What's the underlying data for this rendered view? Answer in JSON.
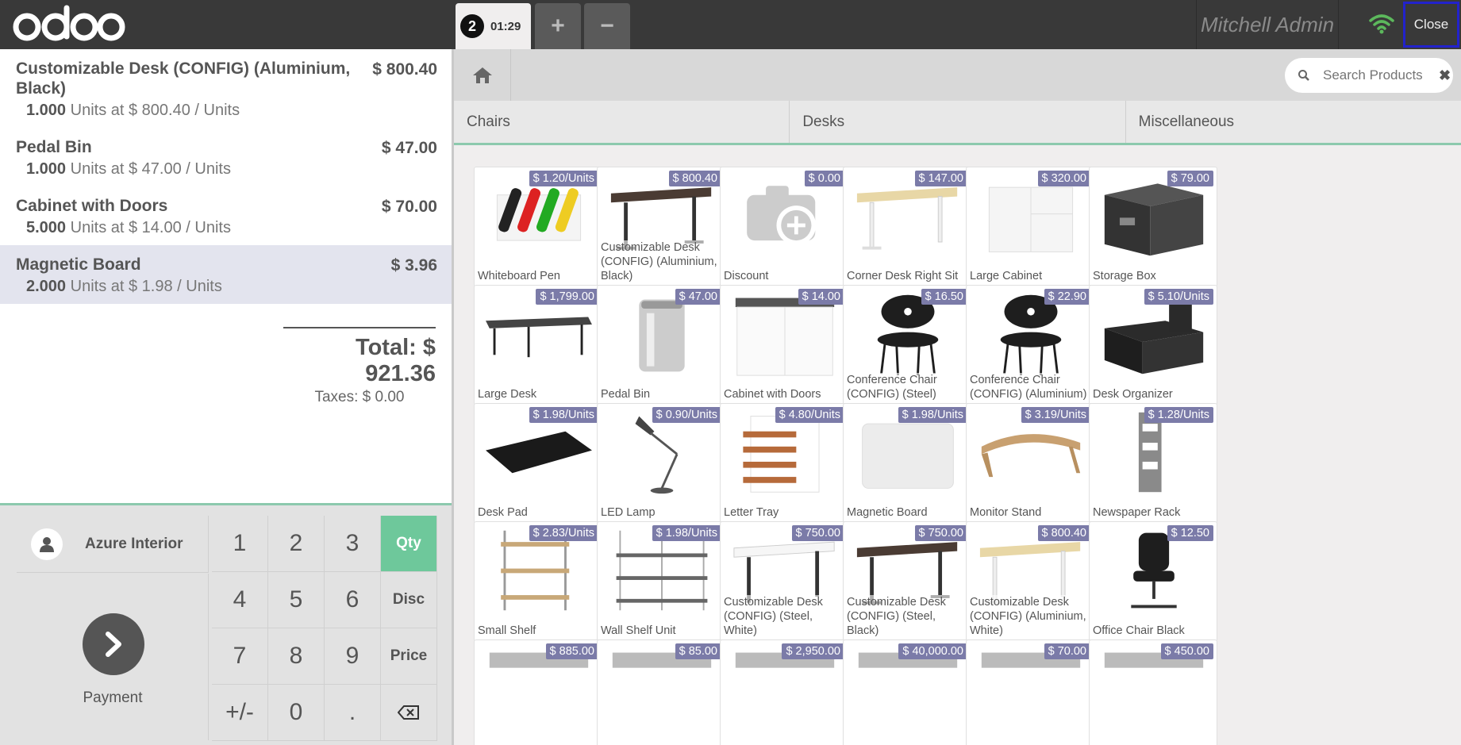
{
  "topbar": {
    "logo_text": "odoo",
    "order_number": "2",
    "order_time": "01:29",
    "add_order_label": "+",
    "delete_order_label": "−",
    "user_name": "Mitchell Admin",
    "close_label": "Close"
  },
  "order": {
    "lines": [
      {
        "name": "Customizable Desk (CONFIG) (Aluminium, Black)",
        "price": "$ 800.40",
        "qty": "1.000",
        "unit_info": "Units at $ 800.40 / Units",
        "selected": false
      },
      {
        "name": "Pedal Bin",
        "price": "$ 47.00",
        "qty": "1.000",
        "unit_info": "Units at $ 47.00 / Units",
        "selected": false
      },
      {
        "name": "Cabinet with Doors",
        "price": "$ 70.00",
        "qty": "5.000",
        "unit_info": "Units at $ 14.00 / Units",
        "selected": false
      },
      {
        "name": "Magnetic Board",
        "price": "$ 3.96",
        "qty": "2.000",
        "unit_info": "Units at $ 1.98 / Units",
        "selected": true
      }
    ],
    "total": "Total: $ 921.36",
    "taxes": "Taxes: $ 0.00"
  },
  "controls": {
    "customer_name": "Azure Interior",
    "payment_label": "Payment",
    "keys": [
      "1",
      "2",
      "3",
      "Qty",
      "4",
      "5",
      "6",
      "Disc",
      "7",
      "8",
      "9",
      "Price",
      "+/-",
      "0",
      "."
    ],
    "active_mode": "Qty"
  },
  "search": {
    "placeholder": "Search Products"
  },
  "categories": [
    "Chairs",
    "Desks",
    "Miscellaneous"
  ],
  "products": [
    {
      "name": "Whiteboard Pen",
      "price": "$ 1.20/Units",
      "icon": "whiteboard-pen"
    },
    {
      "name": "Customizable Desk (CONFIG) (Aluminium, Black)",
      "price": "$ 800.40",
      "icon": "desk-dark"
    },
    {
      "name": "Discount",
      "price": "$ 0.00",
      "icon": "discount-camera"
    },
    {
      "name": "Corner Desk Right Sit",
      "price": "$ 147.00",
      "icon": "desk-light"
    },
    {
      "name": "Large Cabinet",
      "price": "$ 320.00",
      "icon": "cabinet"
    },
    {
      "name": "Storage Box",
      "price": "$ 79.00",
      "icon": "storage-box"
    },
    {
      "name": "Large Desk",
      "price": "$ 1,799.00",
      "icon": "large-desk"
    },
    {
      "name": "Pedal Bin",
      "price": "$ 47.00",
      "icon": "pedal-bin"
    },
    {
      "name": "Cabinet with Doors",
      "price": "$ 14.00",
      "icon": "cabinet-doors"
    },
    {
      "name": "Conference Chair (CONFIG) (Steel)",
      "price": "$ 16.50",
      "icon": "chair"
    },
    {
      "name": "Conference Chair (CONFIG) (Aluminium)",
      "price": "$ 22.90",
      "icon": "chair"
    },
    {
      "name": "Desk Organizer",
      "price": "$ 5.10/Units",
      "icon": "organizer"
    },
    {
      "name": "Desk Pad",
      "price": "$ 1.98/Units",
      "icon": "desk-pad"
    },
    {
      "name": "LED Lamp",
      "price": "$ 0.90/Units",
      "icon": "lamp"
    },
    {
      "name": "Letter Tray",
      "price": "$ 4.80/Units",
      "icon": "letter-tray"
    },
    {
      "name": "Magnetic Board",
      "price": "$ 1.98/Units",
      "icon": "board"
    },
    {
      "name": "Monitor Stand",
      "price": "$ 3.19/Units",
      "icon": "monitor-stand"
    },
    {
      "name": "Newspaper Rack",
      "price": "$ 1.28/Units",
      "icon": "rack"
    },
    {
      "name": "Small Shelf",
      "price": "$ 2.83/Units",
      "icon": "small-shelf"
    },
    {
      "name": "Wall Shelf Unit",
      "price": "$ 1.98/Units",
      "icon": "wall-shelf"
    },
    {
      "name": "Customizable Desk (CONFIG) (Steel, White)",
      "price": "$ 750.00",
      "icon": "desk-white"
    },
    {
      "name": "Customizable Desk (CONFIG) (Steel, Black)",
      "price": "$ 750.00",
      "icon": "desk-dark"
    },
    {
      "name": "Customizable Desk (CONFIG) (Aluminium, White)",
      "price": "$ 800.40",
      "icon": "desk-light"
    },
    {
      "name": "Office Chair Black",
      "price": "$ 12.50",
      "icon": "office-chair"
    },
    {
      "name": "",
      "price": "$ 885.00",
      "icon": "partial"
    },
    {
      "name": "",
      "price": "$ 85.00",
      "icon": "partial"
    },
    {
      "name": "",
      "price": "$ 2,950.00",
      "icon": "partial"
    },
    {
      "name": "",
      "price": "$ 40,000.00",
      "icon": "partial"
    },
    {
      "name": "",
      "price": "$ 70.00",
      "icon": "partial"
    },
    {
      "name": "",
      "price": "$ 450.00",
      "icon": "partial"
    }
  ],
  "colors": {
    "topbar": "#393939",
    "accent_green": "#6ec89b",
    "price_tag": "#7b7ba8",
    "selected_line": "#e3e4ee",
    "close_border": "#2222cc"
  }
}
